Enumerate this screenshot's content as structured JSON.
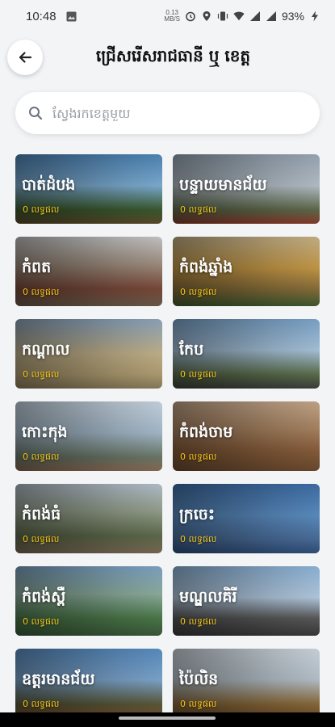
{
  "status_bar": {
    "time": "10:48",
    "data_rate_top": "0.13",
    "data_rate_bottom": "MB/S",
    "battery": "93%"
  },
  "header": {
    "title": "ជ្រើសរើសរាជធានី ឬ ខេត្ត"
  },
  "search": {
    "placeholder": "ស្វែងរកខេត្តមួយ"
  },
  "provinces": [
    {
      "name": "បាត់ដំបង",
      "count": "0 លទ្ធផល",
      "bg": "linear-gradient(180deg,#4f86b8 0%,#7fb0d6 45%,#3b5b2f 80%,#5a4a2a 100%)"
    },
    {
      "name": "បន្ទាយមានជ័យ",
      "count": "0 លទ្ធផល",
      "bg": "linear-gradient(180deg,#9aa9b7 0%,#b8c2cb 45%,#5f6b4c 80%,#8a3a2a 100%)"
    },
    {
      "name": "កំពត",
      "count": "0 លទ្ធផល",
      "bg": "linear-gradient(180deg,#c9c9c9 0%,#a08f80 40%,#7b4a3a 75%,#6b5b4a 100%)"
    },
    {
      "name": "កំពង់ឆ្នាំង",
      "count": "0 លទ្ធផល",
      "bg": "linear-gradient(180deg,#c8b48a 0%,#c79a47 45%,#8a6f3a 75%,#3f5a2f 100%)"
    },
    {
      "name": "កណ្តាល",
      "count": "0 លទ្ធផល",
      "bg": "linear-gradient(180deg,#8ea7bf 0%,#c5b48c 50%,#b29f73 80%,#8a7b5a 100%)"
    },
    {
      "name": "កែប",
      "count": "0 លទ្ធផល",
      "bg": "linear-gradient(180deg,#7da6cc 0%,#aac6de 45%,#5c6f4c 80%,#3b3f3a 100%)"
    },
    {
      "name": "កោះកុង",
      "count": "0 លទ្ធផល",
      "bg": "linear-gradient(180deg,#c9d7e3 0%,#a7bccd 45%,#6c7a6a 80%,#8a6a55 100%)"
    },
    {
      "name": "កំពង់ចាម",
      "count": "0 លទ្ធផល",
      "bg": "linear-gradient(180deg,#c7a98c 0%,#a98462 40%,#8a5f3c 70%,#6b4a2f 100%)"
    },
    {
      "name": "កំពង់ធំ",
      "count": "0 លទ្ធផល",
      "bg": "linear-gradient(180deg,#b7c3cf 0%,#94a08c 40%,#5f6b4c 75%,#7a6a55 100%)"
    },
    {
      "name": "ក្រចេះ",
      "count": "0 លទ្ធផល",
      "bg": "linear-gradient(180deg,#3f6fa8 0%,#5c8fc4 45%,#4a6d9a 80%,#2f4f7a 100%)"
    },
    {
      "name": "កំពង់ស្ពឺ",
      "count": "0 លទ្ធផល",
      "bg": "linear-gradient(180deg,#7fa6c7 0%,#8fb0a0 40%,#4c7a4a 75%,#3a5a3a 100%)"
    },
    {
      "name": "មណ្ឌលគិរី",
      "count": "0 លទ្ធផល",
      "bg": "linear-gradient(180deg,#8fb6da 0%,#b6cde3 45%,#5a5a5a 75%,#3a3a3a 100%)"
    },
    {
      "name": "ឧត្តរមានជ័យ",
      "count": "0 លទ្ធផល",
      "bg": "linear-gradient(180deg,#5a8fc4 0%,#7fa8d0 45%,#5a5a3a 80%,#7a4a2a 100%)"
    },
    {
      "name": "ប៉ៃលិន",
      "count": "0 លទ្ធផល",
      "bg": "linear-gradient(180deg,#cfd8e0 0%,#b7c3cc 45%,#8a6a3a 80%,#6a4a2a 100%)"
    }
  ]
}
